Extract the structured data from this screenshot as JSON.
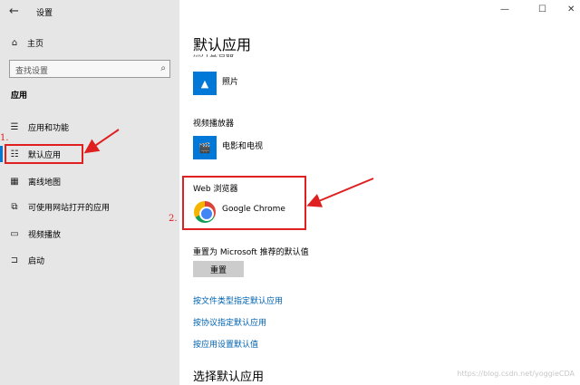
{
  "window": {
    "title": "设置",
    "minimize_glyph": "—",
    "maximize_glyph": "☐",
    "close_glyph": "✕"
  },
  "sidebar": {
    "home_label": "主页",
    "search_placeholder": "查找设置",
    "section_label": "应用",
    "items": [
      {
        "label": "应用和功能",
        "icon": "apps-features-icon"
      },
      {
        "label": "默认应用",
        "icon": "default-apps-icon",
        "selected": true
      },
      {
        "label": "离线地图",
        "icon": "offline-maps-icon"
      },
      {
        "label": "可使用网站打开的应用",
        "icon": "apps-for-websites-icon"
      },
      {
        "label": "视频播放",
        "icon": "video-playback-icon"
      },
      {
        "label": "启动",
        "icon": "startup-icon"
      }
    ]
  },
  "main": {
    "title": "默认应用",
    "clipped_category": "照片查看器",
    "photo_app": "照片",
    "video_category": "视频播放器",
    "video_app": "电影和电视",
    "browser_category": "Web 浏览器",
    "browser_app": "Google Chrome",
    "reset_label": "重置为 Microsoft 推荐的默认值",
    "reset_button": "重置",
    "links": [
      "按文件类型指定默认应用",
      "按协议指定默认应用",
      "按应用设置默认值"
    ],
    "choose_heading": "选择默认应用"
  },
  "annotations": {
    "step1": "1.",
    "step2": "2.",
    "color": "#e02020"
  },
  "watermark": "https://blog.csdn.net/yoggieCDA",
  "colors": {
    "accent": "#0078d7",
    "link": "#0063b1",
    "sidebar_bg": "#e6e6e6"
  }
}
